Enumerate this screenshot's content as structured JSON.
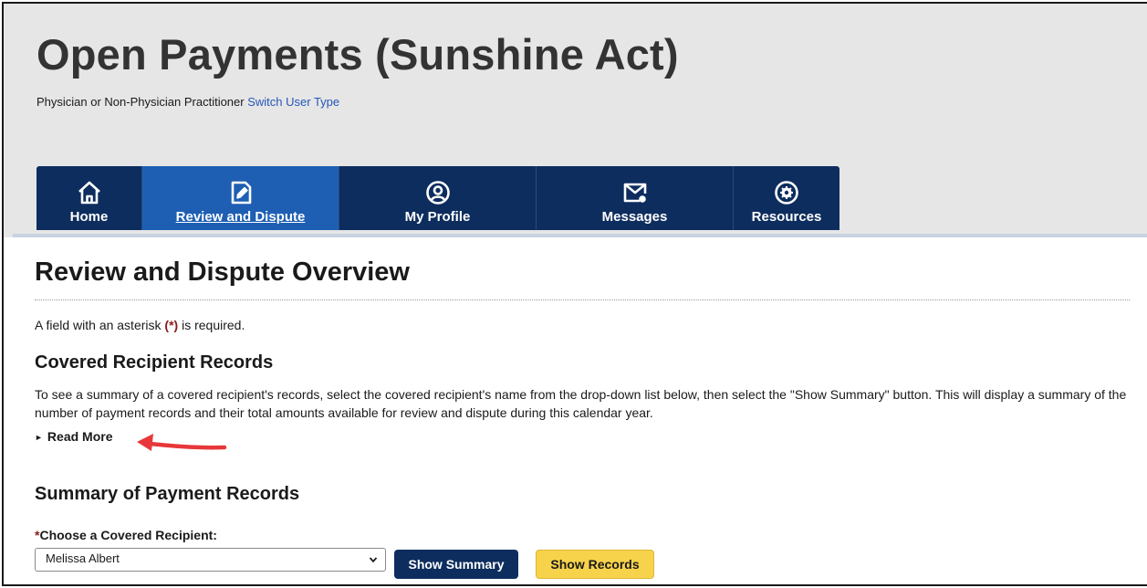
{
  "header": {
    "site_title": "Open Payments (Sunshine Act)",
    "user_type_text": "Physician or Non-Physician Practitioner",
    "switch_link": "Switch User Type"
  },
  "nav": {
    "tabs": [
      {
        "label": "Home",
        "icon": "home-icon",
        "active": false
      },
      {
        "label": "Review and Dispute",
        "icon": "edit-document-icon",
        "active": true
      },
      {
        "label": "My Profile",
        "icon": "user-circle-icon",
        "active": false
      },
      {
        "label": "Messages",
        "icon": "envelope-icon",
        "active": false
      },
      {
        "label": "Resources",
        "icon": "gear-circle-icon",
        "active": false
      }
    ]
  },
  "main": {
    "page_title": "Review and Dispute Overview",
    "required_note_before": "A field with an asterisk",
    "required_note_asterisk": "(*)",
    "required_note_after": "is required.",
    "covered_section": {
      "heading": "Covered Recipient Records",
      "description": "To see a summary of a covered recipient's records, select the covered recipient's name from the drop-down list below, then select the \"Show Summary\" button. This will display a summary of the number of payment records and their total amounts available for review and dispute during this calendar year.",
      "read_more": "Read More"
    },
    "summary_section": {
      "heading": "Summary of Payment Records",
      "field_asterisk": "*",
      "field_label": "Choose a Covered Recipient:",
      "selected_value": "Melissa Albert",
      "show_summary_button": "Show Summary",
      "show_records_button": "Show Records"
    }
  },
  "colors": {
    "nav_bg": "#0d2d5e",
    "nav_active": "#1e5fb4",
    "header_bg": "#e6e6e6",
    "link": "#2457b8",
    "asterisk": "#8b1a1a",
    "secondary_button": "#f7d24b",
    "annotation_arrow": "#e8373a"
  }
}
